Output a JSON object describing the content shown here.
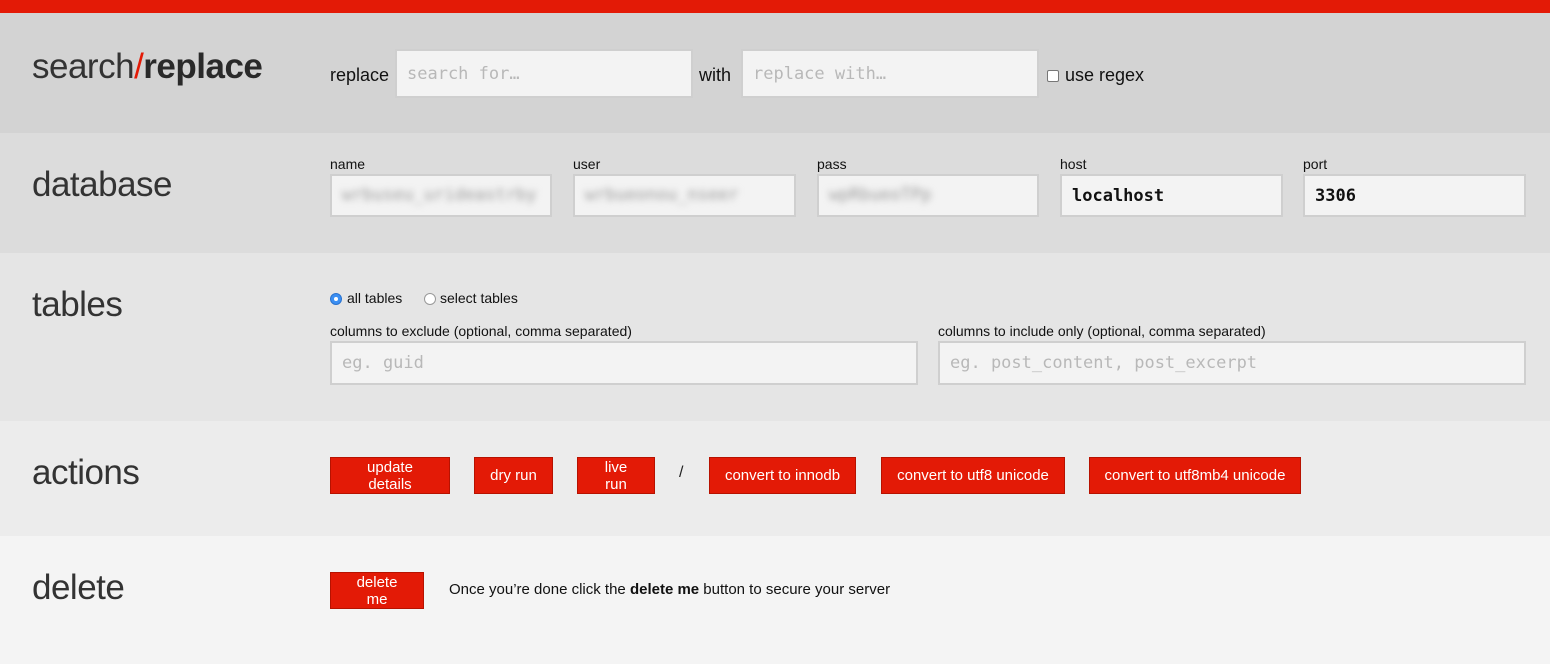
{
  "title": {
    "prefix": "search",
    "slash": "/",
    "suffix": "replace"
  },
  "search": {
    "replace_label": "replace",
    "search_placeholder": "search for…",
    "with_label": "with",
    "replace_placeholder": "replace with…",
    "regex_label": "use regex",
    "regex_checked": false
  },
  "database": {
    "heading": "database",
    "fields": {
      "name": {
        "label": "name",
        "value": "wrbuseu_urideastrby"
      },
      "user": {
        "label": "user",
        "value": "wrbueonou_nseer"
      },
      "pass": {
        "label": "pass",
        "value": "wpRbueoTPp"
      },
      "host": {
        "label": "host",
        "value": "localhost"
      },
      "port": {
        "label": "port",
        "value": "3306"
      }
    }
  },
  "tables": {
    "heading": "tables",
    "all_label": "all tables",
    "select_label": "select tables",
    "selected": "all",
    "exclude_label": "columns to exclude (optional, comma separated)",
    "exclude_placeholder": "eg. guid",
    "include_label": "columns to include only (optional, comma separated)",
    "include_placeholder": "eg. post_content, post_excerpt"
  },
  "actions": {
    "heading": "actions",
    "update": "update details",
    "dry_run": "dry run",
    "live_run": "live run",
    "separator": "/",
    "innodb": "convert to innodb",
    "utf8": "convert to utf8 unicode",
    "utf8mb4": "convert to utf8mb4 unicode"
  },
  "delete": {
    "heading": "delete",
    "button": "delete me",
    "note_before": "Once you’re done click the ",
    "note_bold": "delete me",
    "note_after": " button to secure your server"
  },
  "colors": {
    "accent": "#e31a06",
    "radio_on": "#3b8ff3"
  }
}
